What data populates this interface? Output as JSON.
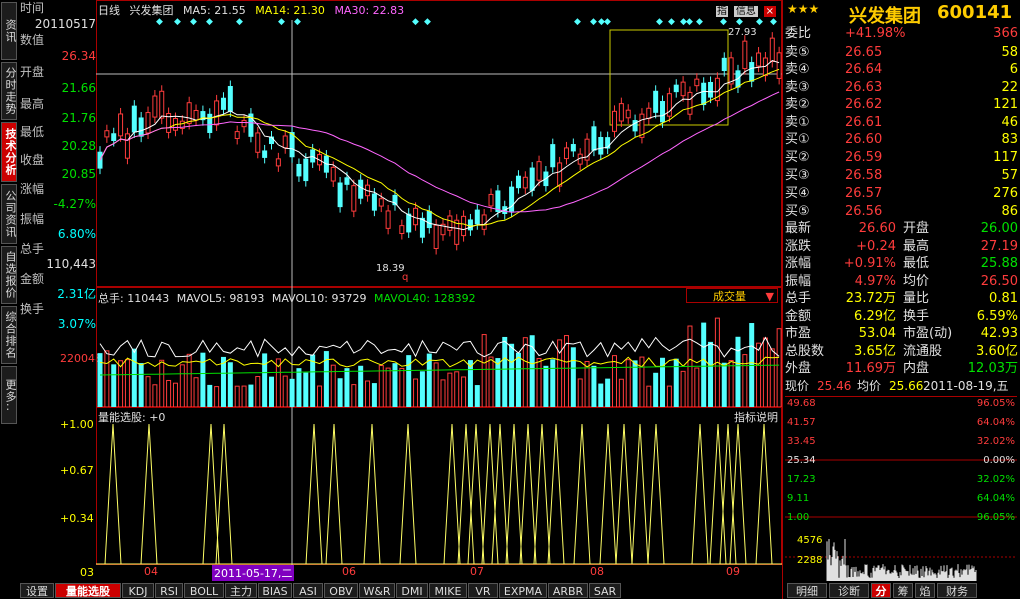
{
  "left_tabs": [
    "分时走势",
    "技术分析",
    "公司资讯",
    "自选报价",
    "综合排名",
    "更多.."
  ],
  "left_tabs_active": 1,
  "left_top_tab": "资讯",
  "info": {
    "labels": [
      "时间",
      "数值",
      "开盘",
      "最高",
      "最低",
      "收盘",
      "涨幅",
      "振幅",
      "总手",
      "金额",
      "换手"
    ],
    "date": "20110517",
    "open": "26.34",
    "high": "21.66",
    "low": "21.76",
    "close": "20.28",
    "change_pct": "20.85",
    "amplitude": "-4.27%",
    "volume_label_pct": "6.80%",
    "volume": "110,443",
    "amount": "2.31亿",
    "turnover": "3.07%"
  },
  "main_header": {
    "period": "日线",
    "stock": "兴发集团",
    "ma5": "MA5: 21.55",
    "ma14": "MA14: 21.30",
    "ma30": "MA30: 22.83"
  },
  "main_annotations": {
    "high_mark": "27.93",
    "low_mark": "18.39",
    "q_mark": "q"
  },
  "vol_header": {
    "total": "总手: 110443",
    "mavol5": "MAVOL5: 98193",
    "mavol10": "MAVOL10: 93729",
    "mavol40": "MAVOL40: 128392",
    "dropdown": "成交量"
  },
  "vol_ylabel": "220048",
  "ind_header": {
    "name": "量能选股: +0",
    "help": "指标说明"
  },
  "ind_ylabels": [
    "+1.00",
    "+0.67",
    "+0.34",
    "03"
  ],
  "x_labels": [
    "04",
    "06",
    "07",
    "08",
    "09"
  ],
  "cursor_date": "2011-05-17,二",
  "bottom_tabs": [
    "设置",
    "量能选股",
    "KDJ",
    "RSI",
    "BOLL",
    "主力",
    "BIAS",
    "ASI",
    "OBV",
    "W&R",
    "DMI",
    "MIKE",
    "VR",
    "EXPMA",
    "ARBR",
    "SAR"
  ],
  "bottom_tabs_active": 1,
  "top_icons": {
    "home": "指",
    "info": "信息",
    "close": "×"
  },
  "quote": {
    "title": "兴发集团",
    "code": "600141",
    "weibi_label": "委比",
    "weibi": "+41.98%",
    "weicha": "366",
    "sells": [
      {
        "label": "卖⑤",
        "price": "26.65",
        "vol": "58"
      },
      {
        "label": "卖④",
        "price": "26.64",
        "vol": "6"
      },
      {
        "label": "卖③",
        "price": "26.63",
        "vol": "22"
      },
      {
        "label": "卖②",
        "price": "26.62",
        "vol": "121"
      },
      {
        "label": "卖①",
        "price": "26.61",
        "vol": "46"
      }
    ],
    "buys": [
      {
        "label": "买①",
        "price": "26.60",
        "vol": "83"
      },
      {
        "label": "买②",
        "price": "26.59",
        "vol": "117"
      },
      {
        "label": "买③",
        "price": "26.58",
        "vol": "57"
      },
      {
        "label": "买④",
        "price": "26.57",
        "vol": "276"
      },
      {
        "label": "买⑤",
        "price": "26.56",
        "vol": "86"
      }
    ],
    "stats": [
      {
        "l1": "最新",
        "v1": "26.60",
        "l2": "开盘",
        "v2": "26.00"
      },
      {
        "l1": "涨跌",
        "v1": "+0.24",
        "l2": "最高",
        "v2": "27.19"
      },
      {
        "l1": "涨幅",
        "v1": "+0.91%",
        "l2": "最低",
        "v2": "25.88"
      },
      {
        "l1": "振幅",
        "v1": "4.97%",
        "l2": "均价",
        "v2": "26.50"
      },
      {
        "l1": "总手",
        "v1": "23.72万",
        "l2": "量比",
        "v2": "0.81"
      },
      {
        "l1": "金额",
        "v1": "6.29亿",
        "l2": "换手",
        "v2": "6.59%"
      },
      {
        "l1": "市盈",
        "v1": "53.04",
        "l2": "市盈(动)",
        "v2": "42.93"
      },
      {
        "l1": "总股数",
        "v1": "3.65亿",
        "l2": "流通股",
        "v2": "3.60亿"
      },
      {
        "l1": "外盘",
        "v1": "11.69万",
        "l2": "内盘",
        "v2": "12.03万"
      }
    ],
    "now_label": "现价",
    "now_val": "25.46",
    "avg_label": "均价",
    "avg_val": "25.66",
    "now_date": "2011-08-19,五"
  },
  "mini_chart": {
    "left_labels": [
      "49.68",
      "41.57",
      "33.45",
      "25.34",
      "17.23",
      "9.11",
      "1.00"
    ],
    "right_labels": [
      "96.05%",
      "64.04%",
      "32.02%",
      "0.00%",
      "32.02%",
      "64.04%",
      "96.05%"
    ],
    "vol_labels": [
      "4576",
      "2288"
    ]
  },
  "right_tabs": [
    "明细",
    "诊断",
    "分",
    "筹",
    "焰",
    "财务"
  ],
  "right_tabs_active": 2
}
